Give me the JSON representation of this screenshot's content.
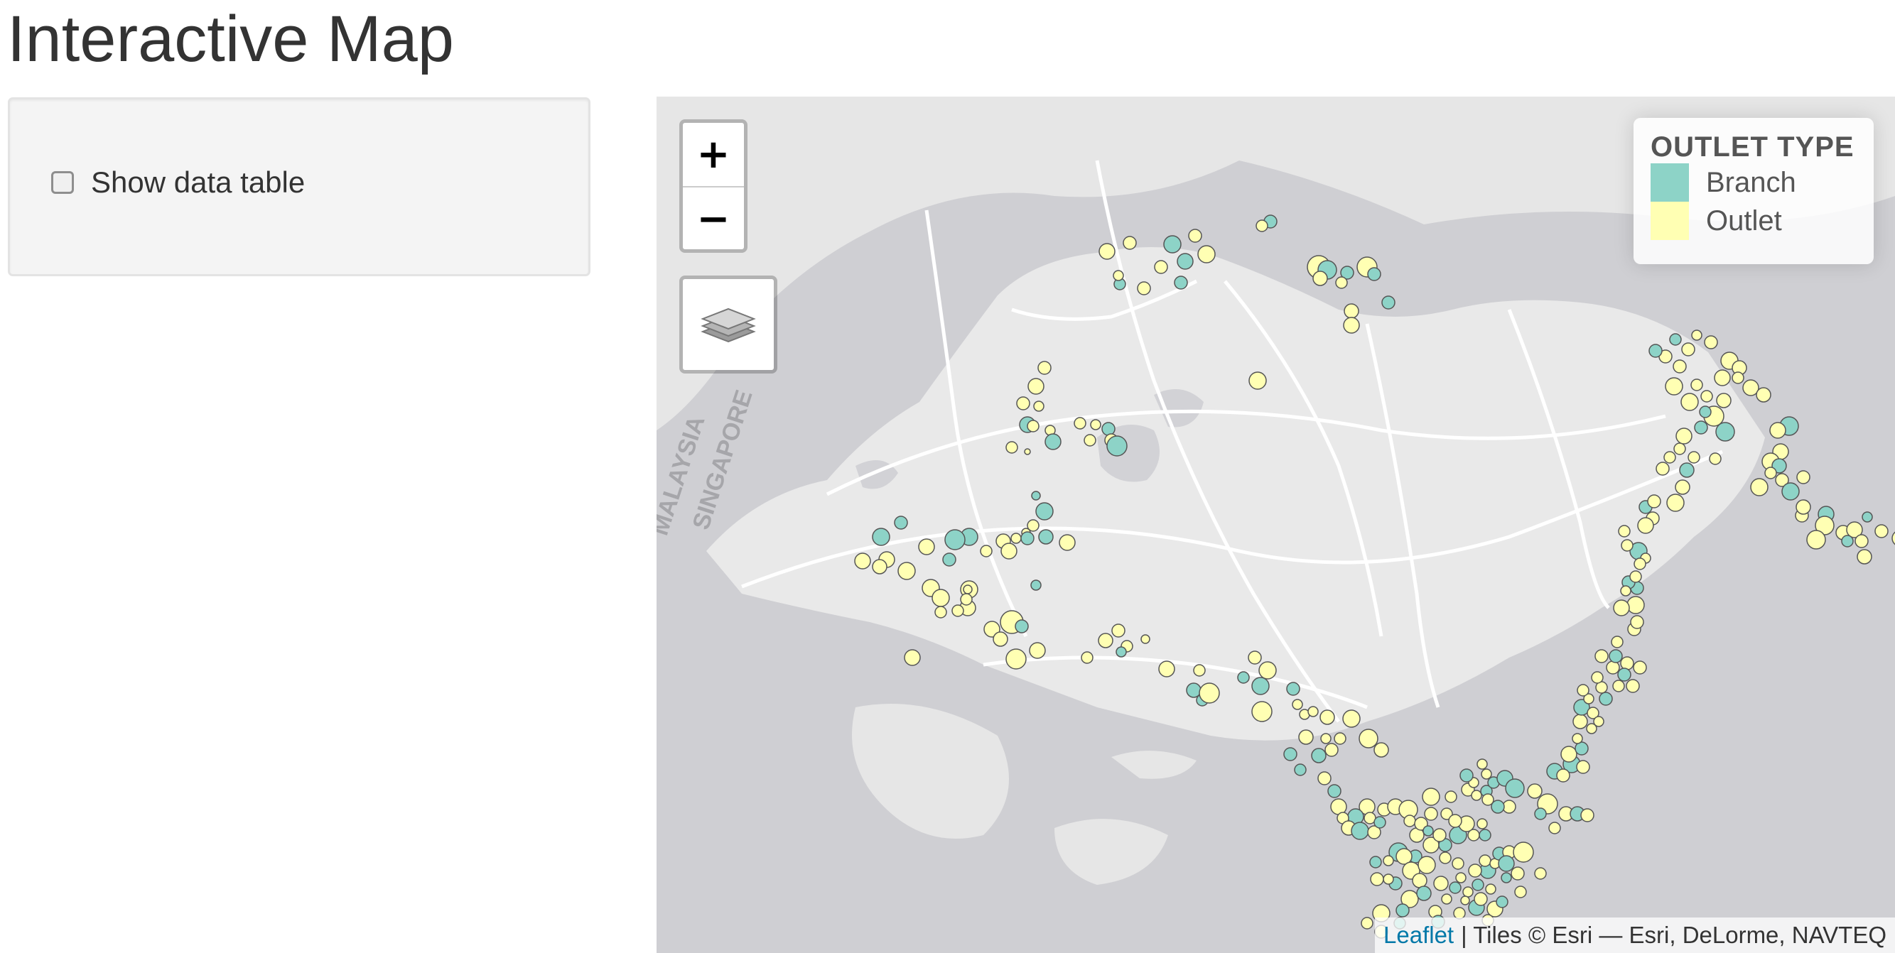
{
  "page": {
    "title": "Interactive Map"
  },
  "sidebar": {
    "show_table_label": "Show data table",
    "show_table_checked": false
  },
  "map": {
    "zoom_in_label": "+",
    "zoom_out_label": "−",
    "background_color": "#cfcfd3",
    "land_color": "#e8e8e8",
    "road_color": "#ffffff",
    "basemap_labels": [
      "MALAYSIA",
      "SINGAPORE"
    ],
    "legend": {
      "title": "OUTLET TYPE",
      "items": [
        {
          "label": "Branch",
          "color": "#8dd3c7"
        },
        {
          "label": "Outlet",
          "color": "#ffffb3"
        }
      ]
    },
    "attribution": {
      "link_text": "Leaflet",
      "text": "| Tiles © Esri — Esri, DeLorme, NAVTEQ"
    }
  }
}
